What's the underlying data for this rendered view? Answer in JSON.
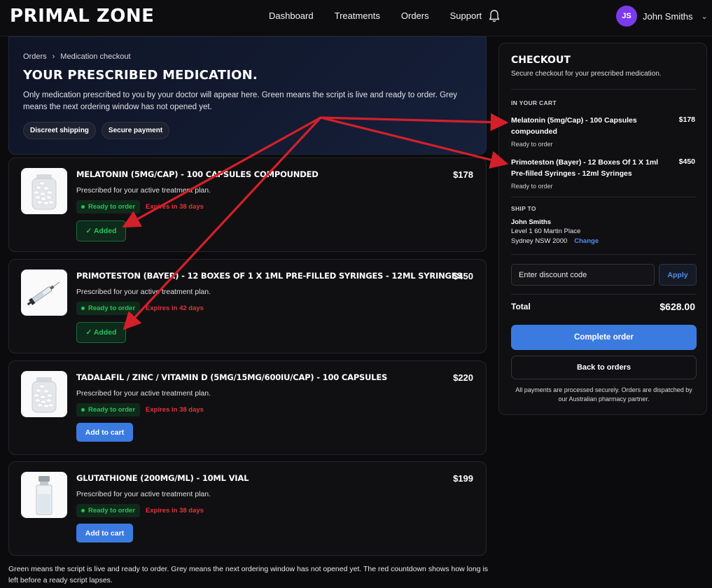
{
  "app": {
    "logo": "PRIMAL ZONE"
  },
  "nav": {
    "items": [
      "Dashboard",
      "Treatments",
      "Orders",
      "Support"
    ]
  },
  "user": {
    "initials": "JS",
    "name": "John Smiths"
  },
  "hero": {
    "breadcrumb": [
      "Orders",
      "Medication checkout"
    ],
    "title": "YOUR PRESCRIBED MEDICATION.",
    "description": "Only medication prescribed to you by your doctor will appear here. Green means the script is live and ready to order. Grey means the next ordering window has not opened yet.",
    "pills": [
      "Discreet shipping",
      "Secure payment"
    ]
  },
  "items": [
    {
      "title": "MELATONIN (5MG/CAP) - 100 CAPSULES COMPOUNDED",
      "price": "$178",
      "subtitle": "Prescribed for your active treatment plan.",
      "status": "Ready to order",
      "expires": "Expires in 38 days",
      "action": "✓ Added",
      "icon": "pill-bottle-icon"
    },
    {
      "title": "PRIMOTESTON (BAYER) - 12 BOXES OF 1 X 1ML PRE-FILLED SYRINGES - 12ML SYRINGES",
      "price": "$450",
      "subtitle": "Prescribed for your active treatment plan.",
      "status": "Ready to order",
      "expires": "Expires in 42 days",
      "action": "✓ Added",
      "icon": "syringe-icon"
    },
    {
      "title": "TADALAFIL / ZINC / VITAMIN D (5MG/15MG/600IU/CAP) - 100 CAPSULES",
      "price": "$220",
      "subtitle": "Prescribed for your active treatment plan.",
      "status": "Ready to order",
      "expires": "Expires in 38 days",
      "action": "Add to cart",
      "icon": "pill-bottle-icon"
    },
    {
      "title": "GLUTATHIONE (200MG/ML) - 10ML VIAL",
      "price": "$199",
      "subtitle": "Prescribed for your active treatment plan.",
      "status": "Ready to order",
      "expires": "Expires in 38 days",
      "action": "Add to cart",
      "icon": "vial-icon"
    }
  ],
  "footnote": "Green means the script is live and ready to order. Grey means the next ordering window has not opened yet. The red countdown shows how long is left before a ready script lapses.",
  "checkout": {
    "title": "CHECKOUT",
    "subtitle": "Secure checkout for your prescribed medication.",
    "cart_label": "IN YOUR CART",
    "cart": [
      {
        "name": "Melatonin (5mg/Cap) - 100 Capsules compounded",
        "price": "$178",
        "status": "Ready to order"
      },
      {
        "name": "Primoteston (Bayer) - 12 Boxes Of 1 X 1ml Pre-filled Syringes - 12ml Syringes",
        "price": "$450",
        "status": "Ready to order"
      }
    ],
    "ship_label": "SHIP TO",
    "ship_name": "John Smiths",
    "ship_line1": "Level 1 60 Martin Place",
    "ship_line2": "Sydney NSW 2000",
    "change_label": "Change",
    "discount_placeholder": "Enter discount code",
    "apply_label": "Apply",
    "total_label": "Total",
    "total_value": "$628.00",
    "complete_label": "Complete order",
    "back_label": "Back to orders",
    "note": "All payments are processed securely. Orders are dispatched by our Australian pharmacy partner."
  },
  "colors": {
    "accent": "#3b7be0",
    "ready": "#22c55e",
    "expires": "#e0353b",
    "annotation": "#d4202a"
  }
}
